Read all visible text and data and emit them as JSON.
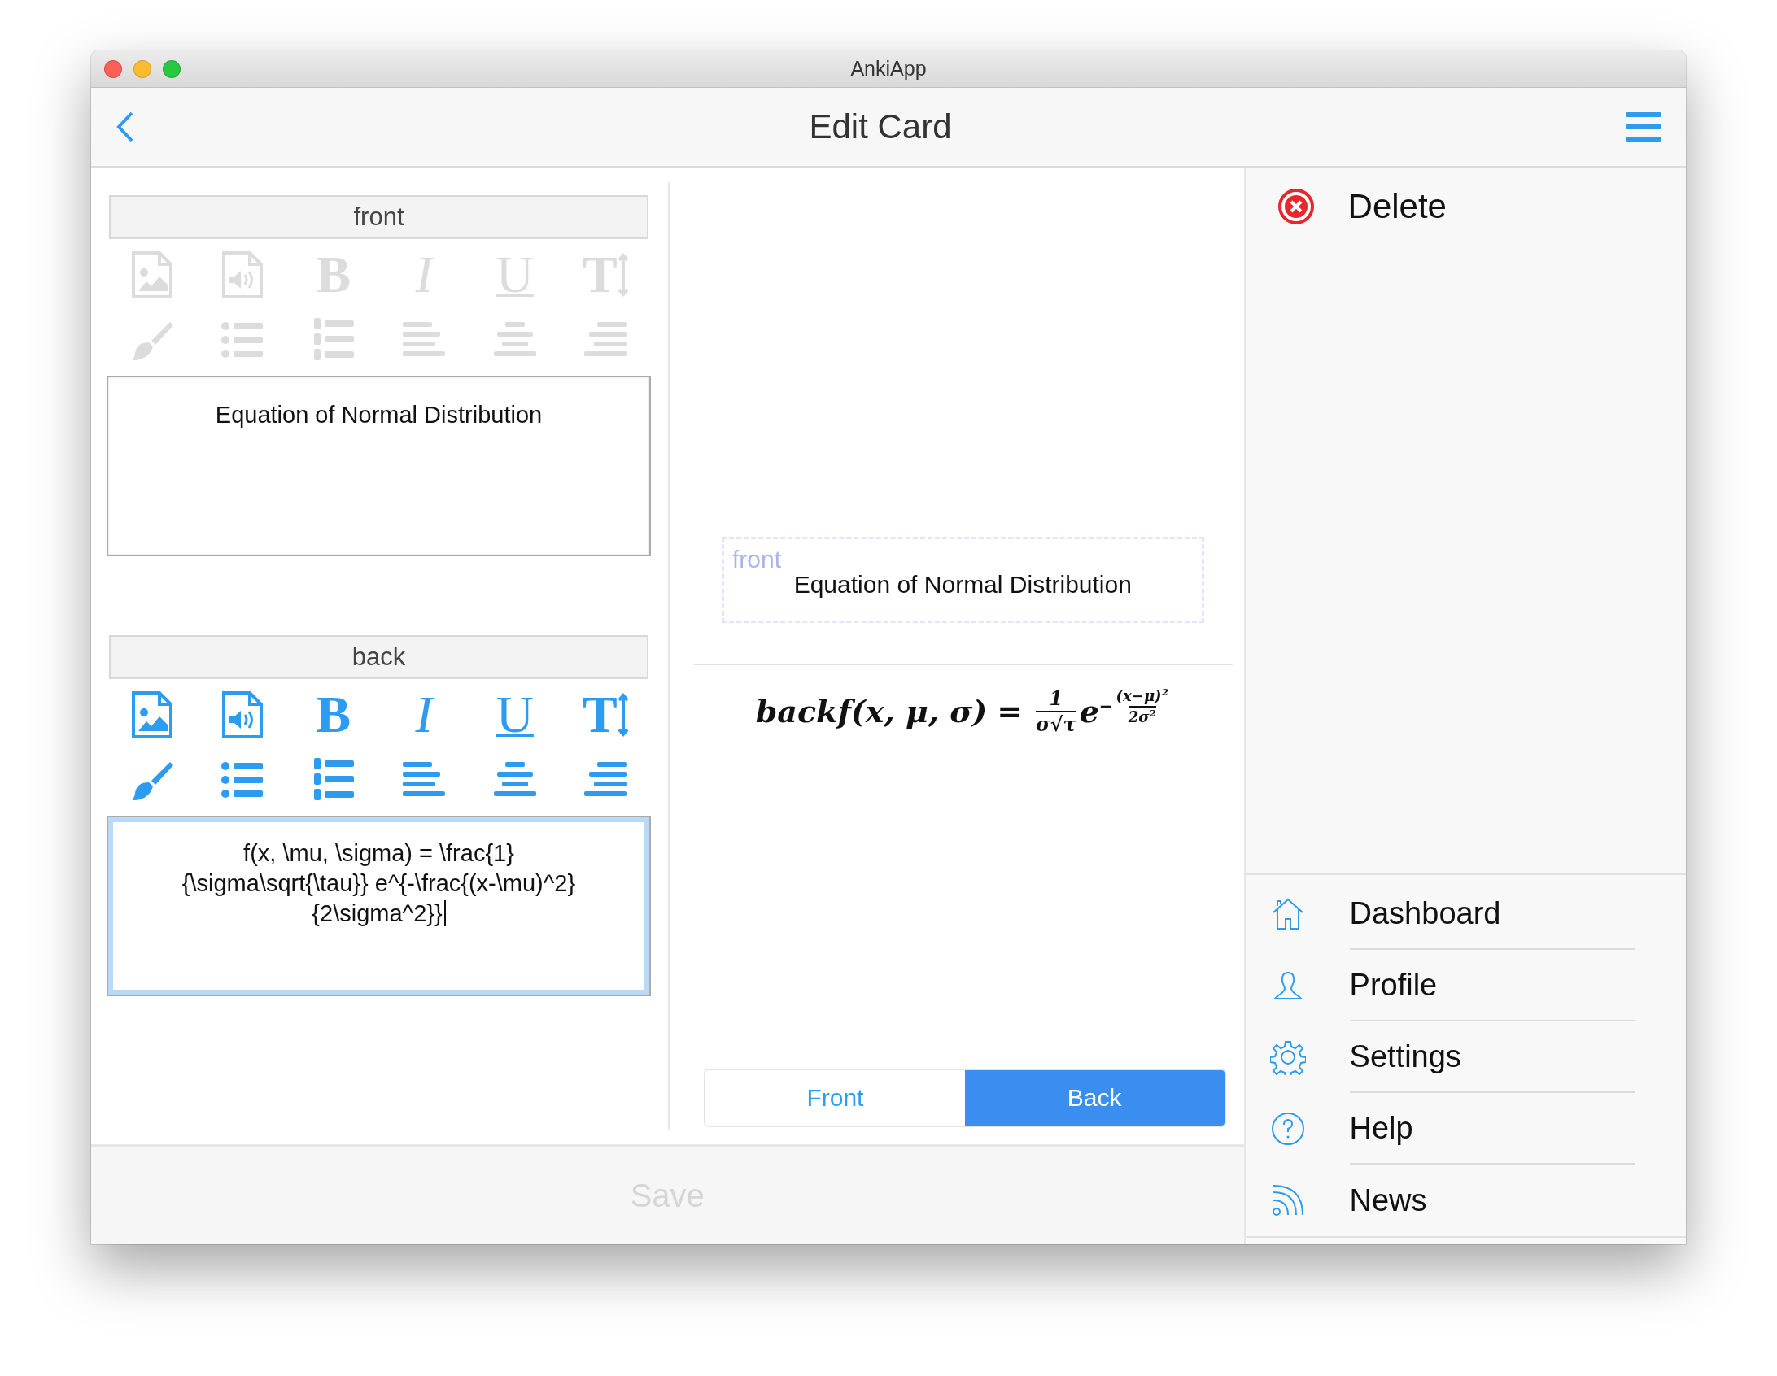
{
  "window": {
    "title": "AnkiApp"
  },
  "nav": {
    "title": "Edit Card"
  },
  "editors": [
    {
      "header": "front",
      "enabled": false,
      "focused": false,
      "text": "Equation of Normal Distribution",
      "tools": [
        {
          "kind": "image"
        },
        {
          "kind": "audio"
        },
        {
          "kind": "bold",
          "label": "B"
        },
        {
          "kind": "italic",
          "label": "I"
        },
        {
          "kind": "underline",
          "label": "U"
        },
        {
          "kind": "size",
          "label": "T"
        },
        {
          "kind": "brush"
        },
        {
          "kind": "bullets"
        },
        {
          "kind": "numbers"
        },
        {
          "kind": "align-left"
        },
        {
          "kind": "align-center"
        },
        {
          "kind": "align-right"
        }
      ]
    },
    {
      "header": "back",
      "enabled": true,
      "focused": true,
      "text": "f(x, \\mu, \\sigma) = \\frac{1}{\\sigma\\sqrt{\\tau}} e^{-\\frac{(x-\\mu)^2}{2\\sigma^2}}",
      "tools": [
        {
          "kind": "image"
        },
        {
          "kind": "audio"
        },
        {
          "kind": "bold",
          "label": "B"
        },
        {
          "kind": "italic",
          "label": "I"
        },
        {
          "kind": "underline",
          "label": "U"
        },
        {
          "kind": "size",
          "label": "T"
        },
        {
          "kind": "brush"
        },
        {
          "kind": "bullets"
        },
        {
          "kind": "numbers"
        },
        {
          "kind": "align-left"
        },
        {
          "kind": "align-center"
        },
        {
          "kind": "align-right"
        }
      ]
    }
  ],
  "preview": {
    "front_label": "front",
    "front_text": "Equation of Normal Distribution",
    "formula": {
      "prefix": "back",
      "lhs": "f(x, μ, σ)",
      "equals": "=",
      "frac_num": "1",
      "frac_den": "σ√τ",
      "base": "e",
      "exp_sign": "−",
      "exp_num": "(x−μ)$^{2}$",
      "exp_den": "2σ$^{2}$"
    },
    "sides": [
      {
        "label": "Front",
        "selected": false
      },
      {
        "label": "Back",
        "selected": true
      }
    ]
  },
  "save_button": {
    "label": "Save",
    "disabled": true
  },
  "sidebar": {
    "delete": "Delete",
    "items": [
      {
        "kind": "home",
        "label": "Dashboard"
      },
      {
        "kind": "profile",
        "label": "Profile"
      },
      {
        "kind": "settings",
        "label": "Settings"
      },
      {
        "kind": "help",
        "label": "Help"
      },
      {
        "kind": "news",
        "label": "News"
      }
    ]
  }
}
